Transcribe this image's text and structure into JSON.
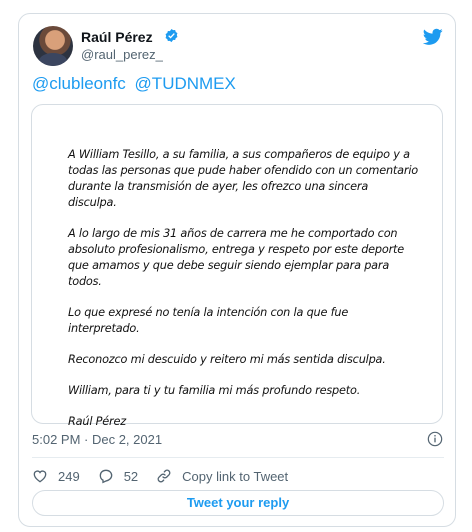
{
  "author": {
    "display_name": "Raúl Pérez",
    "handle": "@raul_perez_",
    "verified": true
  },
  "tweet": {
    "mentions": [
      "@clubleonfc",
      "@TUDNMEX"
    ],
    "letter": [
      "A William Tesillo, a su familia, a sus compañeros de equipo y a todas las personas que pude haber ofendido con un comentario durante la transmisión de ayer, les ofrezco una sincera disculpa.",
      "A lo largo de mis 31 años de carrera me he comportado con absoluto profesionalismo, entrega y respeto por este deporte que amamos y que debe seguir siendo ejemplar para para todos.",
      "Lo que expresé no tenía la intención con la que fue interpretado.",
      "Reconozco mi descuido y reitero mi más sentida disculpa.",
      "William, para ti y tu familia mi más profundo respeto.",
      "Raúl Pérez"
    ],
    "timestamp": "5:02 PM · Dec 2, 2021"
  },
  "actions": {
    "likes": "249",
    "replies": "52",
    "copy_link_label": "Copy link to Tweet"
  },
  "reply_button_label": "Tweet your reply",
  "colors": {
    "accent": "#1d9bf0",
    "text": "#0f1419",
    "secondary": "#536471",
    "border": "#d6dde3"
  },
  "icons": [
    "verified-badge-icon",
    "twitter-bird-icon",
    "info-icon",
    "heart-icon",
    "reply-icon",
    "link-icon"
  ]
}
